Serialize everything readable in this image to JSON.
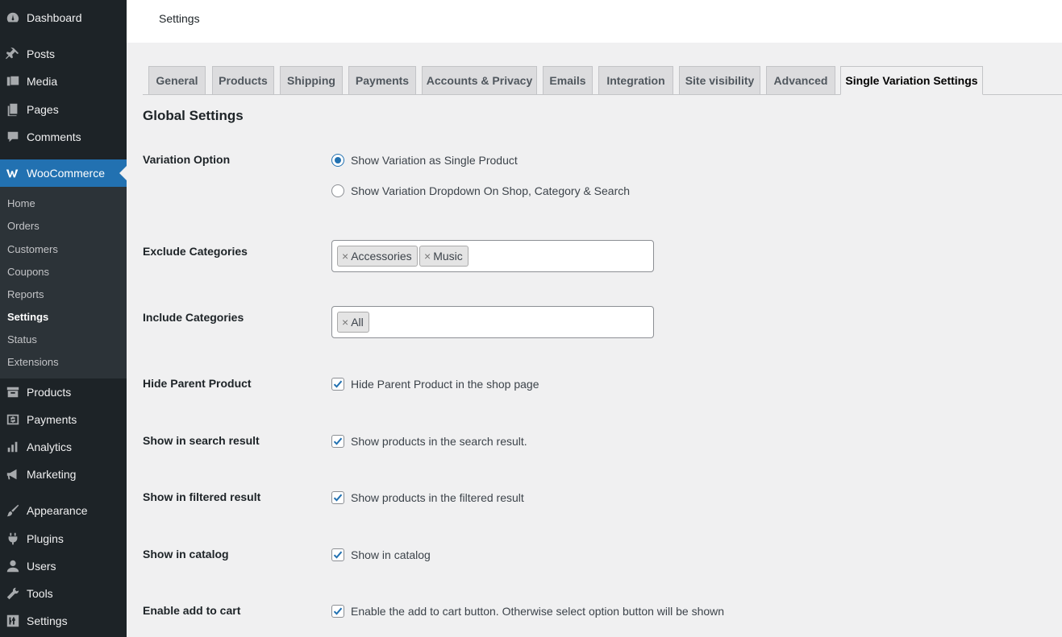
{
  "sidebar": {
    "items": [
      {
        "label": "Dashboard",
        "icon": "dashboard-icon"
      },
      {
        "label": "Posts",
        "icon": "pin-icon"
      },
      {
        "label": "Media",
        "icon": "media-icon"
      },
      {
        "label": "Pages",
        "icon": "pages-icon"
      },
      {
        "label": "Comments",
        "icon": "comment-icon"
      },
      {
        "label": "WooCommerce",
        "icon": "woocommerce-icon"
      },
      {
        "label": "Products",
        "icon": "archive-icon"
      },
      {
        "label": "Payments",
        "icon": "dollar-icon"
      },
      {
        "label": "Analytics",
        "icon": "bar-chart-icon"
      },
      {
        "label": "Marketing",
        "icon": "megaphone-icon"
      },
      {
        "label": "Appearance",
        "icon": "brush-icon"
      },
      {
        "label": "Plugins",
        "icon": "plug-icon"
      },
      {
        "label": "Users",
        "icon": "user-icon"
      },
      {
        "label": "Tools",
        "icon": "wrench-icon"
      },
      {
        "label": "Settings",
        "icon": "sliders-icon"
      }
    ],
    "submenu": [
      "Home",
      "Orders",
      "Customers",
      "Coupons",
      "Reports",
      "Settings",
      "Status",
      "Extensions"
    ]
  },
  "header": {
    "title": "Settings"
  },
  "tabs": [
    "General",
    "Products",
    "Shipping",
    "Payments",
    "Accounts & Privacy",
    "Emails",
    "Integration",
    "Site visibility",
    "Advanced",
    "Single Variation Settings"
  ],
  "section_title": "Global Settings",
  "variation": {
    "label": "Variation Option",
    "options": [
      "Show Variation as Single Product",
      "Show Variation Dropdown On Shop, Category & Search"
    ]
  },
  "exclude": {
    "label": "Exclude Categories",
    "chips": [
      "Accessories",
      "Music"
    ]
  },
  "include": {
    "label": "Include Categories",
    "chips": [
      "All"
    ]
  },
  "chip_remove": "×",
  "checks": [
    {
      "label": "Hide Parent Product",
      "text": "Hide Parent Product in the shop page"
    },
    {
      "label": "Show in search result",
      "text": "Show products in the search result."
    },
    {
      "label": "Show in filtered result",
      "text": "Show products in the filtered result"
    },
    {
      "label": "Show in catalog",
      "text": "Show in catalog"
    },
    {
      "label": "Enable add to cart",
      "text": "Enable the add to cart button. Otherwise select option button will be shown"
    }
  ],
  "colors": {
    "sidebar_bg": "#1d2327",
    "accent": "#2271b1"
  }
}
